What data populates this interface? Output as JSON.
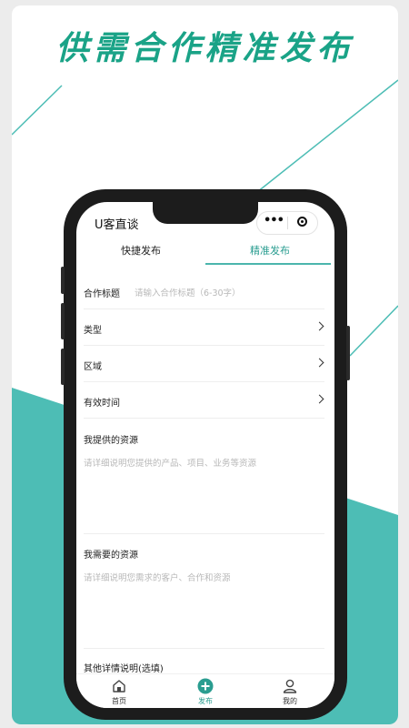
{
  "headline": "供需合作精准发布",
  "app": {
    "title": "U客直谈",
    "capsule_dots": "•••"
  },
  "tabs": [
    {
      "label": "快捷发布",
      "active": false
    },
    {
      "label": "精准发布",
      "active": true
    }
  ],
  "form": {
    "title_label": "合作标题",
    "title_placeholder": "请输入合作标题（6-30字）",
    "type_label": "类型",
    "region_label": "区域",
    "valid_time_label": "有效时间",
    "offer_label": "我提供的资源",
    "offer_placeholder": "请详细说明您提供的产品、项目、业务等资源",
    "need_label": "我需要的资源",
    "need_placeholder": "请详细说明您需求的客户、合作和资源",
    "other_label": "其他详情说明(选填)"
  },
  "tabbar": [
    {
      "label": "首页",
      "icon": "home-icon",
      "active": false
    },
    {
      "label": "发布",
      "icon": "plus-circle-icon",
      "active": true
    },
    {
      "label": "我的",
      "icon": "user-icon",
      "active": false
    }
  ],
  "colors": {
    "accent": "#1aa387",
    "teal": "#4dbdb5",
    "tab_active": "#2a9d90"
  }
}
